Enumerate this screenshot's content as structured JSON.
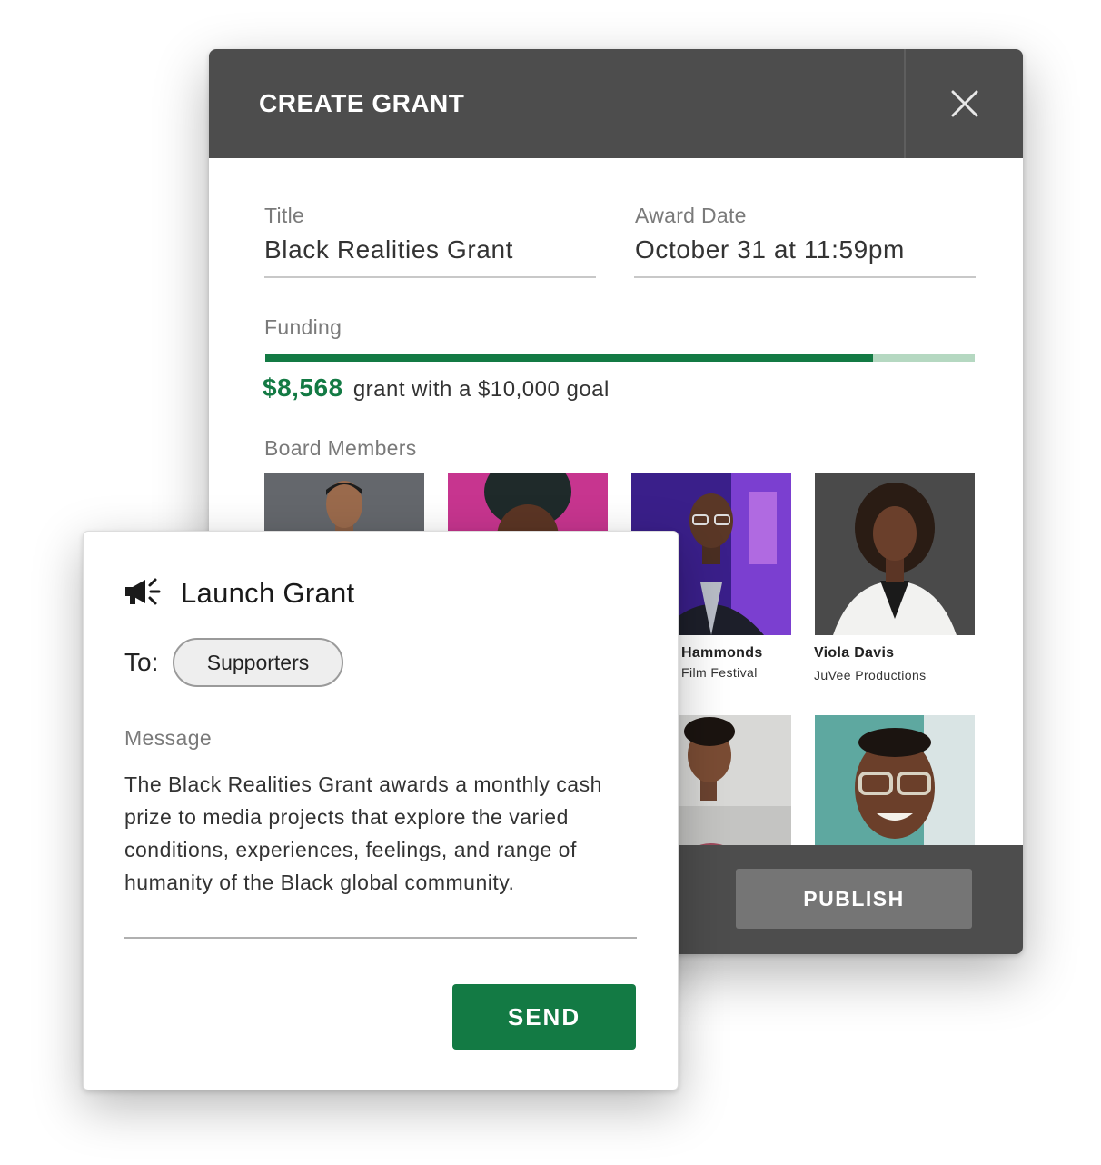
{
  "dialog": {
    "title": "CREATE GRANT",
    "close_icon": "close-icon",
    "fields": {
      "title": {
        "label": "Title",
        "value": "Black Realities Grant"
      },
      "award_date": {
        "label": "Award Date",
        "value": "October 31 at 11:59pm"
      }
    },
    "funding": {
      "label": "Funding",
      "amount": "$8,568",
      "suffix": "grant with a $10,000 goal",
      "raised": 8568,
      "goal": 10000,
      "fill_color": "#137a44",
      "track_color": "#b5d8c1"
    },
    "board": {
      "label": "Board Members",
      "members": [
        {
          "name": "",
          "org": "",
          "photo": "portrait-man-dark-backdrop"
        },
        {
          "name": "",
          "org": "",
          "photo": "portrait-woman-pink-backdrop"
        },
        {
          "name": "Hammonds",
          "org": "Film Festival",
          "photo": "portrait-man-glasses-festival"
        },
        {
          "name": "Viola Davis",
          "org": "JuVee Productions",
          "photo": "portrait-woman-white-top"
        },
        {
          "name": "",
          "org": "",
          "photo": "portrait-man-red-shirt"
        },
        {
          "name": "",
          "org": "",
          "photo": "portrait-man-smiling-glasses"
        }
      ]
    },
    "publish_label": "PUBLISH",
    "header_color": "#4d4d4d"
  },
  "launch": {
    "icon": "megaphone-icon",
    "title": "Launch Grant",
    "to_label": "To:",
    "recipient": "Supporters",
    "message_label": "Message",
    "message": "The Black Realities Grant awards a monthly cash prize to media projects that explore the varied conditions, experiences, feelings, and range of humanity of the Black global community.",
    "send_label": "SEND",
    "accent_color": "#137a44"
  }
}
